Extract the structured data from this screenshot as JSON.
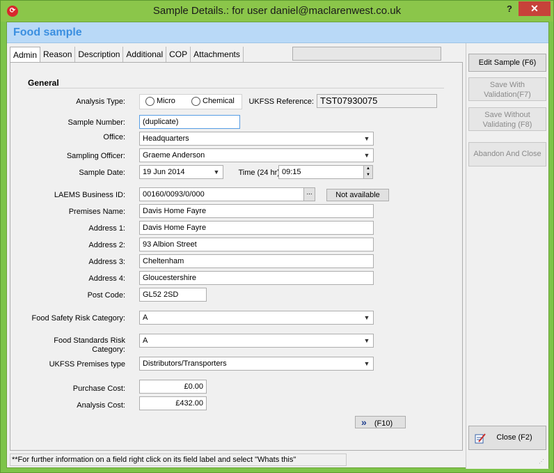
{
  "window": {
    "title": "Sample Details.: for user daniel@maclarenwest.co.uk",
    "help_label": "?",
    "close_label": "✕"
  },
  "header": {
    "title": "Food sample"
  },
  "tabs": [
    "Admin",
    "Reason",
    "Description",
    "Additional",
    "COP",
    "Attachments"
  ],
  "active_tab": "Admin",
  "section": {
    "title": "General"
  },
  "form": {
    "analysis_type": {
      "label": "Analysis Type:",
      "options": [
        "Micro",
        "Chemical"
      ],
      "selected": ""
    },
    "ukfss_reference": {
      "label": "UKFSS Reference:",
      "value": "TST07930075"
    },
    "sample_number": {
      "label": "Sample Number:",
      "value": "(duplicate)"
    },
    "office": {
      "label": "Office:",
      "value": "Headquarters"
    },
    "sampling_officer": {
      "label": "Sampling Officer:",
      "value": "Graeme Anderson"
    },
    "sample_date": {
      "label": "Sample Date:",
      "value": "19 Jun 2014"
    },
    "time": {
      "label": "Time (24 hr):",
      "value": "09:15"
    },
    "laems_business_id": {
      "label": "LAEMS Business ID:",
      "value": "00160/0093/0/000",
      "ellipsis": "...",
      "button": "Not available"
    },
    "premises_name": {
      "label": "Premises Name:",
      "value": "Davis Home Fayre"
    },
    "address_1": {
      "label": "Address 1:",
      "value": "Davis Home Fayre"
    },
    "address_2": {
      "label": "Address 2:",
      "value": "93 Albion Street"
    },
    "address_3": {
      "label": "Address 3:",
      "value": "Cheltenham"
    },
    "address_4": {
      "label": "Address 4:",
      "value": "Gloucestershire"
    },
    "post_code": {
      "label": "Post Code:",
      "value": "GL52 2SD"
    },
    "food_safety_risk": {
      "label": "Food Safety Risk Category:",
      "value": "A"
    },
    "food_standards_risk": {
      "label_line1": "Food Standards Risk",
      "label_line2": "Category:",
      "value": "A"
    },
    "ukfss_premises_type": {
      "label": "UKFSS Premises type",
      "value": "Distributors/Transporters"
    },
    "purchase_cost": {
      "label": "Purchase Cost:",
      "value": "£0.00"
    },
    "analysis_cost": {
      "label": "Analysis Cost:",
      "value": "£432.00"
    },
    "next_button": {
      "icon": "»",
      "label": "(F10)"
    }
  },
  "sidebar": {
    "edit_sample": "Edit Sample (F6)",
    "save_with_validation_1": "Save  With",
    "save_with_validation_2": "Validation(F7)",
    "save_without_validating_1": "Save Without",
    "save_without_validating_2": "Validating (F8)",
    "abandon_and_close": "Abandon And Close",
    "close": "Close (F2)"
  },
  "status_bar": {
    "text": "**For further information on a field right click on its field label and  select \"Whats this\""
  },
  "colors": {
    "accent_title": "#3b8fe0",
    "header_band": "#b9d9f7",
    "window_frame": "#8bc64a",
    "close_button": "#c7423a"
  }
}
